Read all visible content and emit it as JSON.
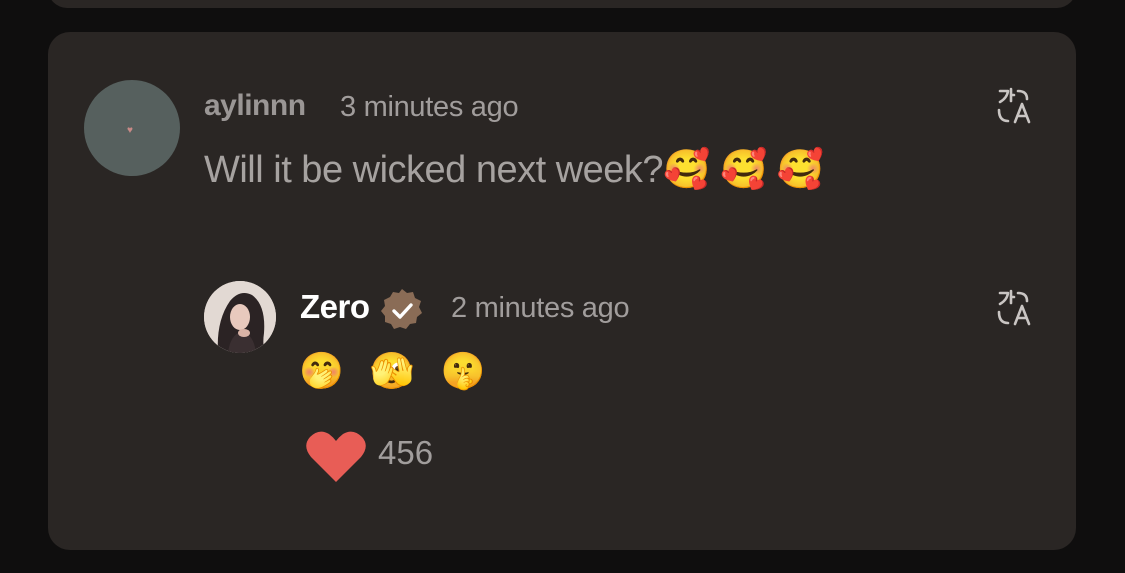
{
  "comment": {
    "username": "aylinnn",
    "time": "3 minutes ago",
    "text": "Will it be wicked next week?🥰 🥰 🥰",
    "translate_icon": "translate-icon"
  },
  "reply": {
    "username": "Zero",
    "verified_icon": "verified-badge-icon",
    "time": "2 minutes ago",
    "text": "🤭 🫣 🤫",
    "translate_icon": "translate-icon",
    "likes": "456",
    "like_icon": "heart-icon"
  },
  "colors": {
    "background": "#0f0e0e",
    "card": "#2a2624",
    "heart": "#e85d56",
    "badge": "#8a6c56"
  }
}
